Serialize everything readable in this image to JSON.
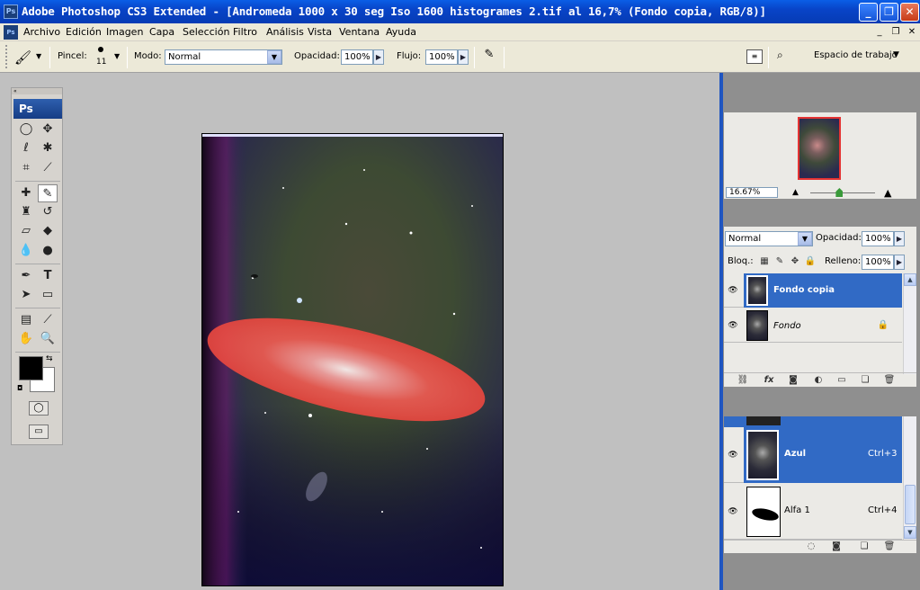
{
  "window": {
    "title": "Adobe Photoshop CS3 Extended - [Andromeda 1000 x 30 seg Iso 1600 histogrames 2.tif al 16,7% (Fondo copia, RGB/8)]",
    "app_icon": "Ps",
    "controls": [
      "minimize-icon",
      "maximize-icon",
      "close-icon"
    ]
  },
  "menu": {
    "items": [
      "Archivo",
      "Edición",
      "Imagen",
      "Capa",
      "Selección",
      "Filtro",
      "Análisis",
      "Vista",
      "Ventana",
      "Ayuda"
    ]
  },
  "options": {
    "brush_label": "Pincel:",
    "brush_size": "11",
    "mode_label": "Modo:",
    "mode_value": "Normal",
    "opacity_label": "Opacidad:",
    "opacity_value": "100%",
    "flow_label": "Flujo:",
    "flow_value": "100%",
    "workspace_label": "Espacio de trabajo"
  },
  "toolbox": {
    "logo": "Ps"
  },
  "navigator": {
    "zoom_value": "16.67%",
    "zoom_slider_fraction": 0.45
  },
  "layers": {
    "blend_mode": "Normal",
    "opacity_label": "Opacidad:",
    "opacity_value": "100%",
    "lock_label": "Bloq.:",
    "fill_label": "Relleno:",
    "fill_value": "100%",
    "items": [
      {
        "name": "Fondo copia",
        "selected": true
      },
      {
        "name": "Fondo",
        "selected": false,
        "locked": true
      }
    ]
  },
  "channels": {
    "items": [
      {
        "name": "Azul",
        "shortcut": "Ctrl+3",
        "selected": true
      },
      {
        "name": "Alfa 1",
        "shortcut": "Ctrl+4",
        "selected": false
      }
    ]
  },
  "colors": {
    "selection_blue": "#316ac5",
    "quickmask_red": "#e8473f",
    "title_blue": "#0a5ee6"
  }
}
